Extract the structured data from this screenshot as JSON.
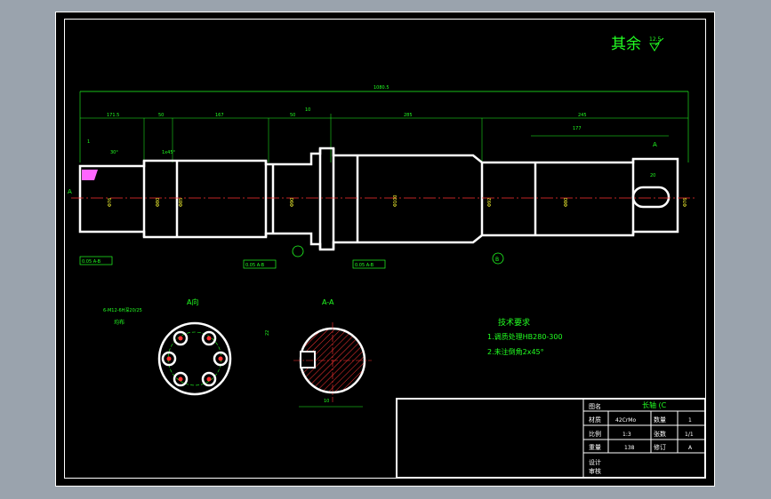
{
  "drawing": {
    "roughness_note": "其余",
    "roughness_value": "12.5",
    "overall_length": "1080.5",
    "dims": {
      "d1": "171.5",
      "d2": "50",
      "d3": "167",
      "d4": "50",
      "d5": "10",
      "d6": "285",
      "d7": "245",
      "d8": "177",
      "d9": "20",
      "d10": "1",
      "d11": "30°",
      "d12": "1x45°"
    },
    "diameters": [
      "Φ76",
      "Φ80",
      "Φ85",
      "Φ90",
      "Φ100",
      "Φ92",
      "Φ80",
      "Φ76"
    ],
    "section_markers": [
      "A",
      "A",
      "B"
    ],
    "tolerance_frames": [
      "0.05 A-B",
      "0.05 A-B",
      "0.05 A-B"
    ],
    "views": {
      "end_view_title": "A向",
      "end_view_note": "6-M12-6H深20/25",
      "end_view_note2": "均布",
      "section_title": "A-A",
      "section_dim": "10",
      "section_vert": "22"
    },
    "tech_req": {
      "title": "技术要求",
      "items": [
        "1.调质处理HB280-300",
        "2.未注倒角2x45°"
      ]
    }
  },
  "title_block": {
    "drawing_name": "长轴 (C",
    "labels": {
      "tuhao": "图名",
      "material": "材质",
      "scale": "比例",
      "weight": "重量",
      "quantity": "数量",
      "sheets": "张数",
      "revision": "修订",
      "designer": "设计",
      "checker": "审核"
    },
    "values": {
      "material": "42CrMo",
      "scale": "1:3",
      "weight": "138",
      "quantity": "1",
      "sheets": "1/1",
      "revision": "A"
    }
  }
}
